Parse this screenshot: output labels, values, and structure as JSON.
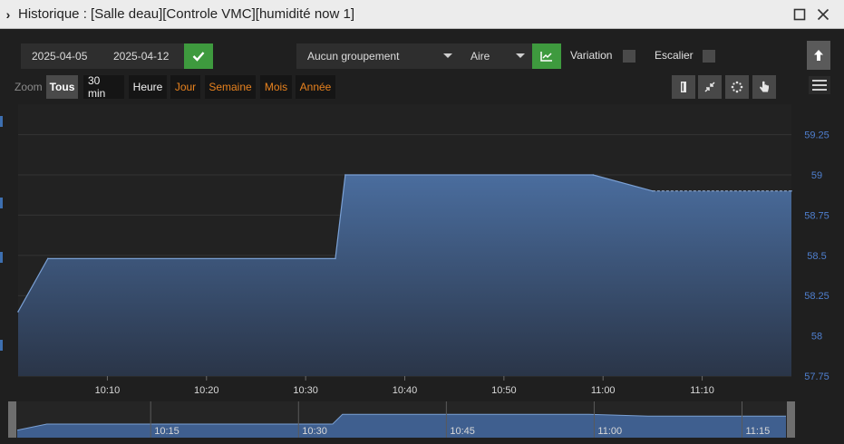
{
  "window": {
    "title": "Historique : [Salle deau][Controle VMC][humidité now 1]"
  },
  "toolbar": {
    "date_start": "2025-04-05",
    "date_end": "2025-04-12",
    "grouping": "Aucun groupement",
    "chart_type": "Aire",
    "variation_label": "Variation",
    "variation_checked": false,
    "staircase_label": "Escalier",
    "staircase_checked": false
  },
  "zoom": {
    "label": "Zoom",
    "buttons": [
      {
        "label": "Tous",
        "state": "active"
      },
      {
        "label": "30 min",
        "state": "enabled"
      },
      {
        "label": "Heure",
        "state": "enabled"
      },
      {
        "label": "Jour",
        "state": "disabled"
      },
      {
        "label": "Semaine",
        "state": "disabled"
      },
      {
        "label": "Mois",
        "state": "disabled"
      },
      {
        "label": "Année",
        "state": "disabled"
      }
    ]
  },
  "tools": [
    "bookmark-icon",
    "compress-icon",
    "loading-icon",
    "pointer-icon"
  ],
  "colors": {
    "area_fill": "#4a6d9e",
    "area_line": "#7aa0d4",
    "axis_text": "#4f7fcf",
    "x_text": "#d8d8d8",
    "green": "#3e9a3e",
    "orange": "#e8821e"
  },
  "chart_data": {
    "type": "area",
    "x_unit": "time",
    "x_range": [
      "10:01",
      "11:19"
    ],
    "y_range": [
      57.75,
      59.4
    ],
    "y_ticks": [
      "57.75",
      "58",
      "58.25",
      "58.5",
      "58.75",
      "59",
      "59.25"
    ],
    "x_ticks": [
      "10:10",
      "10:20",
      "10:30",
      "10:40",
      "10:50",
      "11:00",
      "11:10"
    ],
    "grid": true,
    "points": [
      {
        "x": "10:01",
        "y": 58.15
      },
      {
        "x": "10:04",
        "y": 58.48
      },
      {
        "x": "10:33",
        "y": 58.48
      },
      {
        "x": "10:34",
        "y": 59.0
      },
      {
        "x": "10:59",
        "y": 59.0
      },
      {
        "x": "11:05",
        "y": 58.9
      },
      {
        "x": "11:19",
        "y": 58.9
      }
    ]
  },
  "navigator": {
    "ticks": [
      "10:15",
      "10:30",
      "10:45",
      "11:00",
      "11:15"
    ]
  }
}
